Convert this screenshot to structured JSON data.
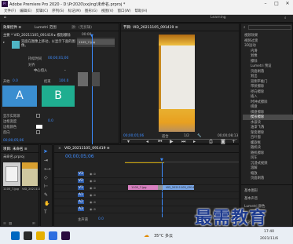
{
  "titlebar": {
    "title": "Adobe Premiere Pro 2020 - D:\\Pr2020\\xxjing\\未命名.prproj *"
  },
  "menu": [
    "文件(F)",
    "编辑(E)",
    "剪辑(C)",
    "序列(S)",
    "标记(M)",
    "图形(G)",
    "视图(V)",
    "窗口(W)",
    "帮助(H)"
  ],
  "workspace": {
    "label": "Learning"
  },
  "effect_controls": {
    "tab": "效果控件 ≡",
    "tab2": "Lumetri 范围",
    "tab3": "源：(无剪辑)",
    "source": "主要 * VID_20211105_091419 ▸ 楔形擦除",
    "time": "00:00",
    "clip_label": "1105_7.jpg",
    "desc": "双面在图像上移动，以显示下面的图像。",
    "duration_label": "持续时间",
    "duration": "00;00;01;00",
    "align_label": "对齐",
    "align": "中心切入",
    "start_label": "开始",
    "start_val": "0.0",
    "end_label": "结束",
    "end_val": "100.0",
    "a": "A",
    "b": "B",
    "show_source": "显示实际源",
    "border_width": "边框宽度",
    "border_width_val": "0.0",
    "border_color": "边框颜色",
    "reverse": "反向",
    "reverse_time": "00;00;05;06"
  },
  "program": {
    "tab": "节目: VID_20211105_091419 ≡",
    "timecode": "00;00;05;06",
    "fit": "适合",
    "fraction": "1/2",
    "duration": "00;00;08;13"
  },
  "effects": {
    "items": [
      "视频效果",
      "视频过渡",
      "3D运动",
      "内滑",
      "划像",
      "擦除",
      "Lumetri 预设",
      "页面剥落",
      "划出",
      "双侧平推门",
      "带状擦除",
      "径向擦除",
      "插入",
      "时钟式擦除",
      "棋盘",
      "棋盘擦除",
      "楔形擦除",
      "水波块",
      "油漆飞溅",
      "渐变擦除",
      "百叶窗",
      "螺旋框",
      "随机块",
      "随机擦除",
      "风车",
      "沉浸式视频",
      "溶解",
      "缩放",
      "页面剥落"
    ],
    "selected": "楔形擦除",
    "side_labels": [
      "基本图形",
      "基本声音",
      "Lumetri 颜色",
      "库",
      "标记"
    ]
  },
  "project": {
    "tab": "项目: 未命名 ≡",
    "file": "未命名.prproj",
    "clip1": "1105_7.jpg",
    "clip2": "VID_2021110"
  },
  "timeline": {
    "tab": "VID_20211105_091419 ≡",
    "timecode": "00;00;05;06",
    "tracks": [
      "V3",
      "V2",
      "V1",
      "A1",
      "A2",
      "A3"
    ],
    "master": "主声道",
    "master_val": "0.0",
    "clip_pink": "1105_7.jpg",
    "clip_blue": "VID_20211105_0914",
    "fx": "fx"
  },
  "taskbar": {
    "weather": "35°C 多云",
    "time": "17:40",
    "date": "2021/11/6"
  },
  "watermark": "最需教育"
}
